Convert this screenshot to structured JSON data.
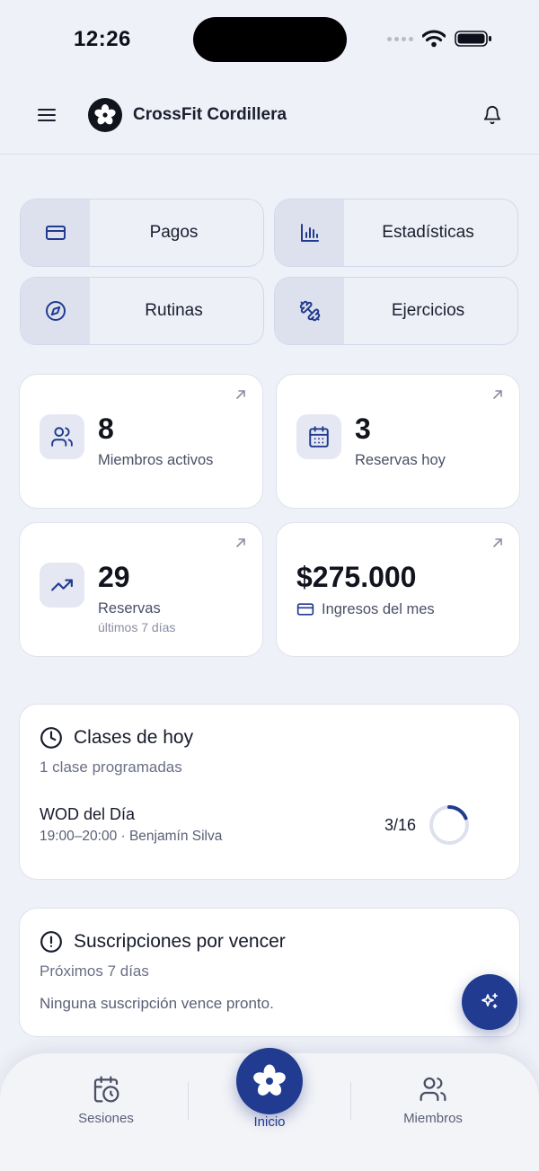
{
  "status": {
    "time": "12:26"
  },
  "header": {
    "brand": "CrossFit Cordillera"
  },
  "quick_actions": [
    {
      "label": "Pagos",
      "icon": "credit-card-icon"
    },
    {
      "label": "Estadísticas",
      "icon": "bar-chart-icon"
    },
    {
      "label": "Rutinas",
      "icon": "compass-icon"
    },
    {
      "label": "Ejercicios",
      "icon": "dumbbell-icon"
    }
  ],
  "stats": {
    "members": {
      "value": "8",
      "label": "Miembros activos",
      "icon": "users-icon"
    },
    "bookings_today": {
      "value": "3",
      "label": "Reservas hoy",
      "icon": "calendar-icon"
    },
    "bookings_week": {
      "value": "29",
      "label": "Reservas",
      "sublabel": "últimos 7 días",
      "icon": "trending-up-icon"
    },
    "revenue": {
      "value": "$275.000",
      "label": "Ingresos del mes",
      "icon": "credit-card-icon"
    }
  },
  "classes": {
    "title": "Clases de hoy",
    "subtitle": "1 clase programadas",
    "items": [
      {
        "name": "WOD del Día",
        "detail": "19:00–20:00 · Benjamín Silva",
        "occupancy": "3/16",
        "filled": 3,
        "capacity": 16
      }
    ]
  },
  "subscriptions": {
    "title": "Suscripciones por vencer",
    "subtitle": "Próximos 7 días",
    "empty": "Ninguna suscripción vence pronto."
  },
  "tabbar": {
    "sessions": "Sesiones",
    "home": "Inicio",
    "members": "Miembros"
  },
  "colors": {
    "accent": "#203b8f",
    "background": "#eff1f8",
    "card": "#ffffff"
  }
}
